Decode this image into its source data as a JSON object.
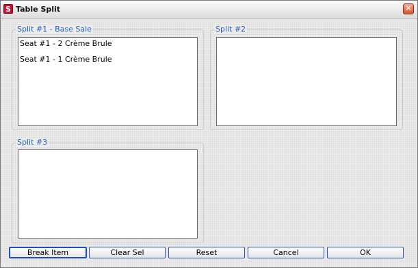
{
  "window": {
    "title": "Table Split",
    "app_icon_letter": "S",
    "close_glyph": "✕"
  },
  "splits": [
    {
      "label": "Split #1 - Base Sale",
      "items": [
        "Seat #1 - 2 Crème Brule",
        "Seat #1 - 1 Crème Brule"
      ]
    },
    {
      "label": "Split #2",
      "items": []
    },
    {
      "label": "Split #3",
      "items": []
    }
  ],
  "buttons": {
    "break_item": "Break Item",
    "clear_sel": "Clear Sel",
    "reset": "Reset",
    "cancel": "Cancel",
    "ok": "OK"
  },
  "colors": {
    "group_label": "#2a5fb8",
    "button_border": "#2d55a7",
    "close_button": "#d8552f"
  }
}
